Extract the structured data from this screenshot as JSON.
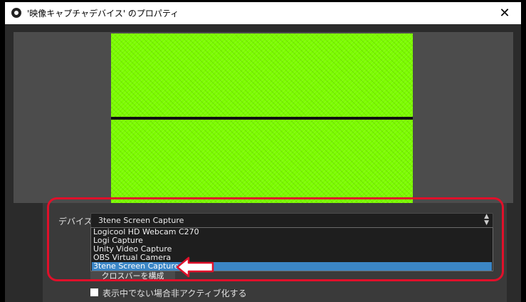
{
  "window": {
    "title": "'映像キャプチャデバイス' のプロパティ",
    "close_symbol": "✕"
  },
  "device": {
    "label": "デバイス",
    "selected_value": "3tene Screen Capture",
    "options": [
      "Logicool HD Webcam C270",
      "Logi Capture",
      "Unity Video Capture",
      "OBS Virtual Camera",
      "3tene Screen Capture"
    ]
  },
  "crossbar_button_label": "クロスバーを構成",
  "deactivate_checkbox": {
    "label": "表示中でない場合非アクティブ化する",
    "checked": false
  },
  "colors": {
    "highlight": "#e0102a",
    "selection": "#3b86c6",
    "preview_green": "#7cfc00"
  },
  "icons": {
    "app": "obs-logo-icon",
    "close": "close-icon",
    "select_arrows": "chevron-up-down-icon",
    "annotation_arrow": "left-arrow-annotation"
  }
}
